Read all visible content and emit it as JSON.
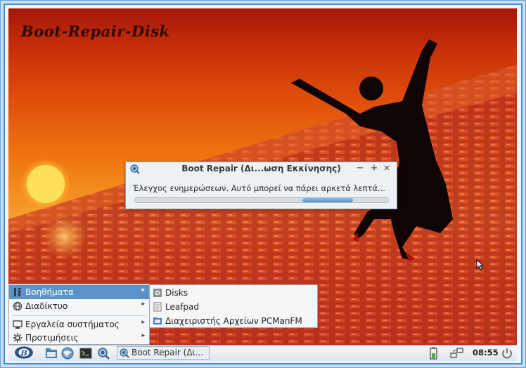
{
  "desktop": {
    "logo_text": "Boot-Repair-Disk"
  },
  "dialog": {
    "title": "Boot Repair (Δι...ωση Εκκίνησης)",
    "icon": "boot-repair-icon",
    "minimize": "−",
    "maximize": "+",
    "close": "✕",
    "message": "Έλεγχος ενημερώσεων. Αυτό μπορεί να πάρει αρκετά λεπτά...",
    "progress": 0.2,
    "progress_start": 0.66
  },
  "start_menu": {
    "items": [
      {
        "label": "Βοηθήματα",
        "icon": "accessories-icon",
        "selected": true,
        "has_submenu": true
      },
      {
        "label": "Διαδίκτυο",
        "icon": "internet-icon",
        "has_submenu": true
      },
      {
        "label": "Εργαλεία συστήματος",
        "icon": "system-tools-icon",
        "has_submenu": true
      },
      {
        "label": "Προτιμήσεις",
        "icon": "preferences-icon",
        "has_submenu": true
      }
    ],
    "arrow": "▸"
  },
  "submenu": {
    "items": [
      {
        "label": "Disks",
        "icon": "disks-icon"
      },
      {
        "label": "Leafpad",
        "icon": "leafpad-icon"
      },
      {
        "label": "Διαχειριστής Αρχείων PCManFM",
        "icon": "file-manager-icon"
      }
    ]
  },
  "taskbar": {
    "start_icon": "start-menu-icon",
    "launchers": [
      "file-manager-icon",
      "web-browser-icon",
      "terminal-icon",
      "boot-repair-icon"
    ],
    "task_label": "Boot Repair (Δι...",
    "clock": "08:55",
    "tray_icons": [
      "battery-icon",
      "network-icon",
      "power-icon"
    ]
  },
  "colors": {
    "menu_highlight": "#5b93c9",
    "frame_border": "#3d8fd6",
    "progress_fill": "#4d8fc9"
  }
}
